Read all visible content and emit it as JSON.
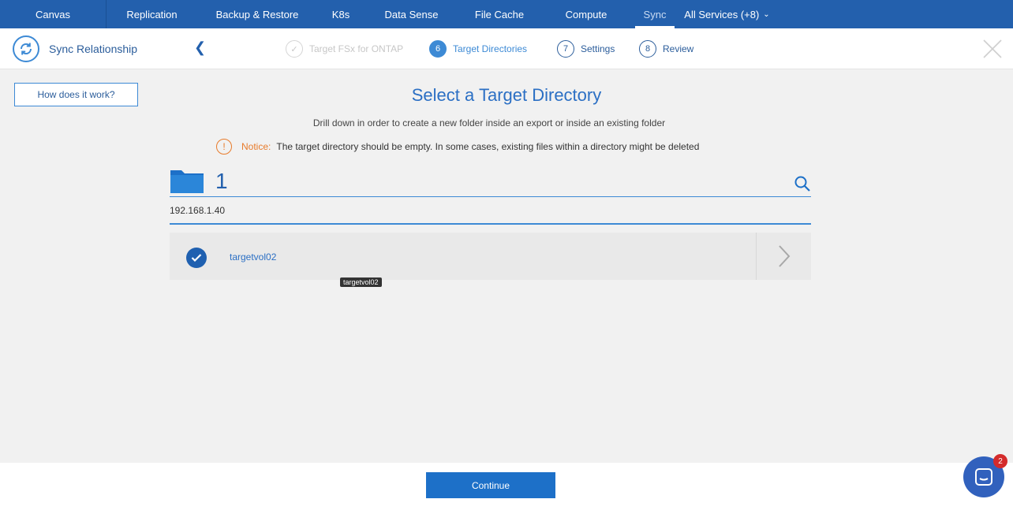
{
  "nav": {
    "items": [
      {
        "label": "Canvas",
        "width": 134
      },
      {
        "label": "Replication",
        "width": 115
      },
      {
        "label": "Backup & Restore",
        "width": 152
      },
      {
        "label": "K8s",
        "width": 60
      },
      {
        "label": "Data Sense",
        "width": 119
      },
      {
        "label": "File Cache",
        "width": 104
      },
      {
        "label": "Compute",
        "width": 116
      },
      {
        "label": "Sync",
        "width": 58
      },
      {
        "label": "All Services (+8)",
        "width": 120
      }
    ],
    "active": "Sync"
  },
  "wizard": {
    "title": "Sync Relationship",
    "steps": [
      {
        "number": "",
        "label": "Target FSx for ONTAP",
        "state": "done"
      },
      {
        "number": "6",
        "label": "Target Directories",
        "state": "current"
      },
      {
        "number": "7",
        "label": "Settings",
        "state": "future"
      },
      {
        "number": "8",
        "label": "Review",
        "state": "future"
      }
    ]
  },
  "help": {
    "label": "How does it work?"
  },
  "main": {
    "title": "Select a Target Directory",
    "subtitle": "Drill down in order to create a new folder inside an export or inside an existing folder",
    "notice_label": "Notice:",
    "notice_text": "The target directory should be empty. In some cases, existing files within a directory might be deleted",
    "path_value": "1",
    "server": "192.168.1.40",
    "rows": [
      {
        "label": "targetvol02",
        "selected": true
      }
    ],
    "tooltip": "targetvol02"
  },
  "footer": {
    "continue_label": "Continue"
  },
  "chat": {
    "badge": "2"
  },
  "colors": {
    "nav_bg": "#2360ad",
    "accent": "#3d8ad5",
    "primary_button": "#1d70c8",
    "warning": "#e87b2b",
    "badge": "#d42b2b"
  }
}
